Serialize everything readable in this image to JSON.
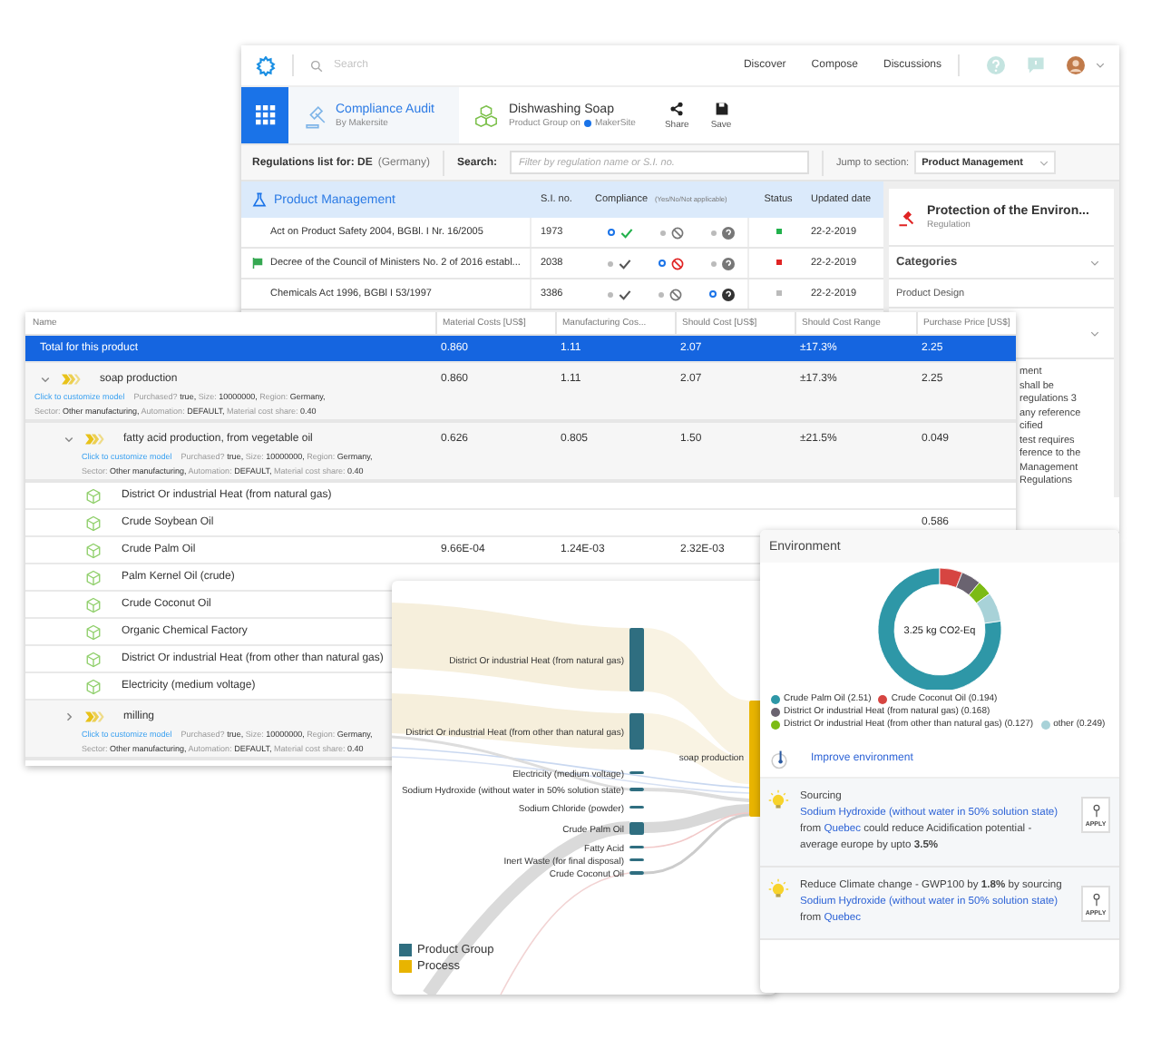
{
  "compliance_window": {
    "topbar": {
      "search_placeholder": "Search",
      "nav": [
        "Discover",
        "Compose",
        "Discussions"
      ]
    },
    "app": {
      "title": "Compliance Audit",
      "subtitle": "By Makersite"
    },
    "product": {
      "title": "Dishwashing Soap",
      "subtitle": "Product Group on",
      "site": "MakerSite"
    },
    "actions": [
      {
        "kind": "share",
        "label": "Share"
      },
      {
        "kind": "save",
        "label": "Save"
      }
    ],
    "regulations_for": {
      "label": "Regulations list for: DE",
      "country": "(Germany)"
    },
    "search": {
      "label": "Search:",
      "placeholder": "Filter by regulation name or S.I. no."
    },
    "jump": {
      "label": "Jump to section:",
      "value": "Product Management"
    },
    "table": {
      "section": "Product Management",
      "columns": [
        "S.I. no.",
        "Compliance",
        "Status",
        "Updated date"
      ],
      "compliance_hint": "(Yes/No/Not applicable)",
      "rows": [
        {
          "name": "Act on Product Safety 2004, BGBl. I Nr. 16/2005",
          "flagged": false,
          "si_no": "1973",
          "options": [
            {
              "selected": true
            },
            {
              "selected": false
            },
            {
              "selected": false
            }
          ],
          "color": "#22b14c",
          "updated": "22-2-2019"
        },
        {
          "name": "Decree of the Council of Ministers No. 2 of 2016 establ...",
          "flagged": true,
          "si_no": "2038",
          "options": [
            {
              "selected": false
            },
            {
              "selected": true
            },
            {
              "selected": false
            }
          ],
          "color": "#e02424",
          "updated": "22-2-2019"
        },
        {
          "name": "Chemicals Act 1996, BGBl I 53/1997",
          "flagged": false,
          "si_no": "3386",
          "options": [
            {
              "selected": false
            },
            {
              "selected": false
            },
            {
              "selected": true
            }
          ],
          "color": "#bbbbbb",
          "updated": "22-2-2019"
        }
      ]
    },
    "detail": {
      "title": "Protection of the Environ...",
      "subtitle": "Regulation",
      "categories_title": "Categories",
      "category": "Product Design",
      "description_lines": [
        "ment",
        "shall be",
        "regulations 3",
        "any reference",
        "cified",
        "test requires",
        "ference to the",
        "Management",
        "Regulations"
      ]
    }
  },
  "cost_window": {
    "columns": [
      "Name",
      "Material Costs [US$]",
      "Manufacturing Cos...",
      "Should Cost [US$]",
      "Should Cost Range",
      "Purchase Price [US$]"
    ],
    "rows": [
      {
        "kind": "total",
        "name": "Total for this product",
        "selected": true,
        "values": [
          "0.860",
          "1.11",
          "2.07",
          "±17.3%",
          "2.25"
        ]
      },
      {
        "kind": "process",
        "name": "soap production",
        "selected": false,
        "expanded": true,
        "values": [
          "0.860",
          "1.11",
          "2.07",
          "±17.3%",
          "2.25"
        ],
        "details": {
          "link": "Click to customize model",
          "lines": [
            "Purchased? **true,** Size: **10000000,** Region: **Germany,**",
            "Sector: **Other manufacturing,** Automation: **DEFAULT,** Material cost share: **0.40**"
          ]
        },
        "children": [
          {
            "kind": "process",
            "name": "fatty acid production, from vegetable oil",
            "selected": false,
            "expanded": true,
            "values": [
              "0.626",
              "0.805",
              "1.50",
              "±21.5%",
              "0.049"
            ],
            "details": {
              "link": "Click to customize model",
              "lines": [
                "Purchased? **true,** Size: **10000000,** Region: **Germany,**",
                "Sector: **Other manufacturing,** Automation: **DEFAULT,** Material cost share: **0.40**"
              ]
            },
            "children": [
              {
                "kind": "material",
                "name": "District Or industrial Heat (from natural gas)",
                "selected": false
              },
              {
                "kind": "material",
                "name": "Crude Soybean Oil",
                "selected": false,
                "purchase_price": "0.586"
              },
              {
                "kind": "material",
                "name": "Crude Palm Oil",
                "selected": false,
                "values": [
                  "9.66E-04",
                  "1.24E-03",
                  "2.32E-03"
                ]
              },
              {
                "kind": "material",
                "name": "Palm Kernel Oil (crude)",
                "selected": false
              },
              {
                "kind": "material",
                "name": "Crude Coconut Oil",
                "selected": false
              },
              {
                "kind": "material",
                "name": "Organic Chemical Factory",
                "selected": false
              },
              {
                "kind": "material",
                "name": "District Or industrial Heat (from other than natural gas)",
                "selected": false
              },
              {
                "kind": "material",
                "name": "Electricity (medium voltage)",
                "selected": false
              }
            ]
          },
          {
            "kind": "process",
            "name": "milling",
            "selected": false,
            "expanded": false,
            "details": {
              "link": "Click to customize model",
              "lines": [
                "Purchased? **true,** Size: **10000000,** Region: **Germany,**",
                "Sector: **Other manufacturing,** Automation: **DEFAULT,** Material cost share: **0.40**"
              ]
            }
          }
        ]
      }
    ]
  },
  "sankey_window": {
    "nodes": [
      {
        "label": "District Or industrial Heat (from natural gas)",
        "kind": "product_group"
      },
      {
        "label": "District Or industrial Heat (from other than natural gas)",
        "kind": "product_group"
      },
      {
        "label": "Electricity (medium voltage)",
        "kind": "product_group"
      },
      {
        "label": "Sodium Hydroxide (without water in 50% solution state)",
        "kind": "product_group"
      },
      {
        "label": "Sodium Chloride (powder)",
        "kind": "product_group"
      },
      {
        "label": "Crude Palm Oil",
        "kind": "product_group"
      },
      {
        "label": "Fatty Acid",
        "kind": "product_group"
      },
      {
        "label": "Inert Waste (for final disposal)",
        "kind": "product_group"
      },
      {
        "label": "Crude Coconut Oil",
        "kind": "product_group"
      },
      {
        "label": "soap production",
        "kind": "process"
      }
    ],
    "legend": [
      {
        "label": "Product Group",
        "kind": "product_group"
      },
      {
        "label": "Process",
        "kind": "process"
      }
    ]
  },
  "environment_window": {
    "title": "Environment",
    "center_label": "3.25 kg CO2-Eq",
    "chart_data": {
      "type": "donut",
      "categories": [
        "Crude Palm Oil (2.51)",
        "Crude Coconut Oil (0.194)",
        "District Or industrial Heat (from natural gas) (0.168)",
        "District Or industrial Heat (from other than natural gas) (0.127)",
        "other (0.249)"
      ],
      "series": [
        {
          "values": [
            2.51,
            0.194,
            0.168,
            0.127,
            0.249
          ]
        }
      ]
    },
    "legend": [
      {
        "color": "#2e97a7"
      },
      {
        "color": "#d64541"
      },
      {
        "color": "#6a6370"
      },
      {
        "color": "#7cbb14"
      },
      {
        "color": "#a8d2d8"
      }
    ],
    "improve_link": "Improve environment",
    "suggestions": [
      {
        "segments": [
          {
            "kind": "text",
            "text": "Sourcing "
          },
          {
            "kind": "link",
            "text": "Sodium Hydroxide (without water in 50% solution state)"
          },
          {
            "kind": "text",
            "text": " from "
          },
          {
            "kind": "link",
            "text": "Quebec"
          },
          {
            "kind": "text",
            "text": " could reduce Acidification potential - average europe by upto **3.5%**"
          }
        ],
        "action": "APPLY"
      },
      {
        "segments": [
          {
            "kind": "text",
            "text": "Reduce Climate change - GWP100 by **1.8%** by sourcing "
          },
          {
            "kind": "link",
            "text": "Sodium Hydroxide (without water in 50% solution state)"
          },
          {
            "kind": "text",
            "text": " from "
          },
          {
            "kind": "link",
            "text": "Quebec"
          }
        ],
        "action": "APPLY"
      }
    ]
  }
}
